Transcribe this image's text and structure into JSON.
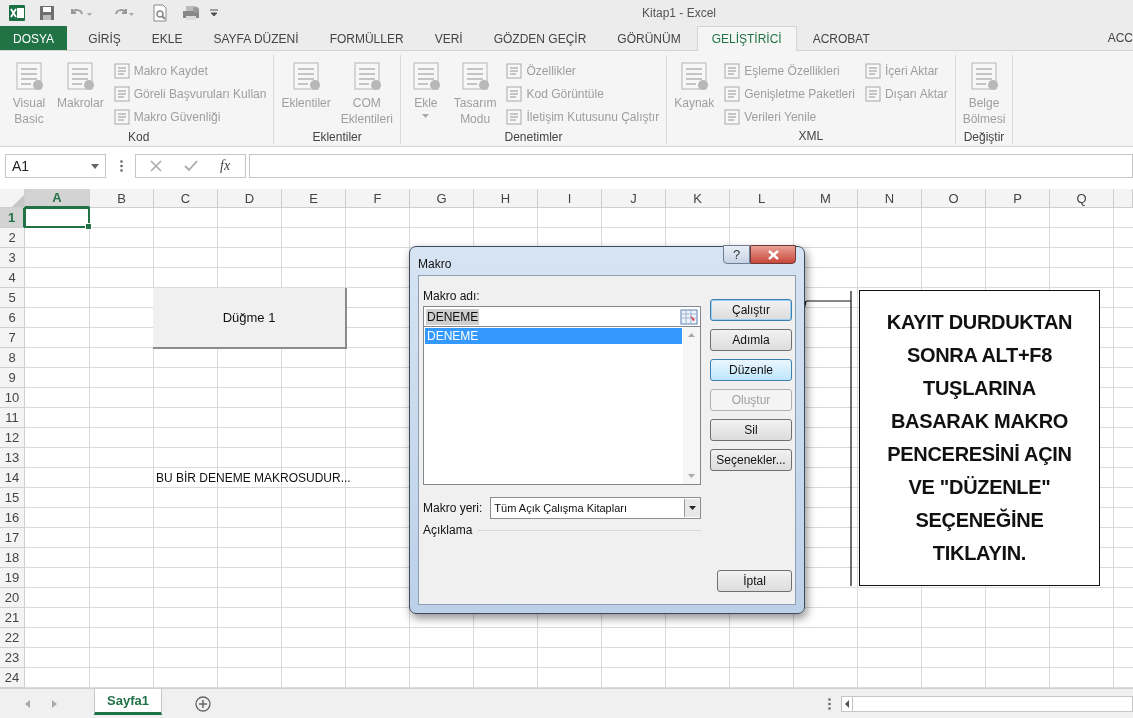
{
  "title_bar": {
    "title": "Kitap1 - Excel"
  },
  "tabs": [
    {
      "label": "DOSYA",
      "kind": "file",
      "selected": false
    },
    {
      "label": "GİRİŞ",
      "kind": "tab",
      "selected": false
    },
    {
      "label": "EKLE",
      "kind": "tab",
      "selected": false
    },
    {
      "label": "SAYFA DÜZENİ",
      "kind": "tab",
      "selected": false
    },
    {
      "label": "FORMÜLLER",
      "kind": "tab",
      "selected": false
    },
    {
      "label": "VERİ",
      "kind": "tab",
      "selected": false
    },
    {
      "label": "GÖZDEN GEÇİR",
      "kind": "tab",
      "selected": false
    },
    {
      "label": "GÖRÜNÜM",
      "kind": "tab",
      "selected": false
    },
    {
      "label": "GELİŞTİRİCİ",
      "kind": "tab",
      "selected": true
    },
    {
      "label": "ACROBAT",
      "kind": "tab",
      "selected": false
    }
  ],
  "account": "ACC",
  "ribbon": {
    "groups": [
      {
        "label": "Kod",
        "items": [
          {
            "kind": "large",
            "label": "Visual Basic",
            "disabled": true,
            "dropdown": false
          },
          {
            "kind": "large",
            "label": "Makrolar",
            "disabled": true,
            "dropdown": false
          },
          {
            "kind": "small",
            "label": "Makro Kaydet",
            "disabled": true
          },
          {
            "kind": "small",
            "label": "Göreli Başvuruları Kullan",
            "disabled": true
          },
          {
            "kind": "small",
            "label": "Makro Güvenliği",
            "disabled": true
          }
        ]
      },
      {
        "label": "Eklentiler",
        "items": [
          {
            "kind": "large",
            "label": "Eklentiler",
            "disabled": true,
            "dropdown": false
          },
          {
            "kind": "large",
            "label": "COM Eklentileri",
            "disabled": true,
            "dropdown": false
          }
        ]
      },
      {
        "label": "Denetimler",
        "items": [
          {
            "kind": "large",
            "label": "Ekle",
            "disabled": true,
            "dropdown": true
          },
          {
            "kind": "large",
            "label": "Tasarım Modu",
            "disabled": true,
            "dropdown": false
          },
          {
            "kind": "small",
            "label": "Özellikler",
            "disabled": true
          },
          {
            "kind": "small",
            "label": "Kod Görüntüle",
            "disabled": true
          },
          {
            "kind": "small",
            "label": "İletişim Kutusunu Çalıştır",
            "disabled": true
          }
        ]
      },
      {
        "label": "XML",
        "items": [
          {
            "kind": "large",
            "label": "Kaynak",
            "disabled": true,
            "dropdown": false
          },
          {
            "kind": "small",
            "label": "Eşleme Özellikleri",
            "disabled": true
          },
          {
            "kind": "small",
            "label": "Genişletme Paketleri",
            "disabled": true
          },
          {
            "kind": "small",
            "label": "Verileri Yenile",
            "disabled": true
          },
          {
            "kind": "small",
            "label": "İçeri Aktar",
            "disabled": true
          },
          {
            "kind": "small",
            "label": "Dışarı Aktar",
            "disabled": true
          }
        ]
      },
      {
        "label": "Değiştir",
        "items": [
          {
            "kind": "large",
            "label": "Belge Bölmesi",
            "disabled": true,
            "dropdown": false
          }
        ]
      }
    ]
  },
  "formula_bar": {
    "name_box": "A1",
    "function_label": "fx"
  },
  "sheet": {
    "columns": [
      {
        "label": "A",
        "selected": true
      },
      {
        "label": "B",
        "selected": false
      },
      {
        "label": "C",
        "selected": false
      },
      {
        "label": "D",
        "selected": false
      },
      {
        "label": "E",
        "selected": false
      },
      {
        "label": "F",
        "selected": false
      },
      {
        "label": "G",
        "selected": false
      },
      {
        "label": "H",
        "selected": false
      },
      {
        "label": "I",
        "selected": false
      },
      {
        "label": "J",
        "selected": false
      },
      {
        "label": "K",
        "selected": false
      },
      {
        "label": "L",
        "selected": false
      },
      {
        "label": "M",
        "selected": false
      },
      {
        "label": "N",
        "selected": false
      },
      {
        "label": "O",
        "selected": false
      },
      {
        "label": "P",
        "selected": false
      },
      {
        "label": "Q",
        "selected": false
      }
    ],
    "rows": [
      {
        "label": "1",
        "selected": true
      },
      {
        "label": "2",
        "selected": false
      },
      {
        "label": "3",
        "selected": false
      },
      {
        "label": "4",
        "selected": false
      },
      {
        "label": "5",
        "selected": false
      },
      {
        "label": "6",
        "selected": false
      },
      {
        "label": "7",
        "selected": false
      },
      {
        "label": "8",
        "selected": false
      },
      {
        "label": "9",
        "selected": false
      },
      {
        "label": "10",
        "selected": false
      },
      {
        "label": "11",
        "selected": false
      },
      {
        "label": "12",
        "selected": false
      },
      {
        "label": "13",
        "selected": false
      },
      {
        "label": "14",
        "selected": false
      },
      {
        "label": "15",
        "selected": false
      },
      {
        "label": "16",
        "selected": false
      },
      {
        "label": "17",
        "selected": false
      },
      {
        "label": "18",
        "selected": false
      },
      {
        "label": "19",
        "selected": false
      },
      {
        "label": "20",
        "selected": false
      },
      {
        "label": "21",
        "selected": false
      },
      {
        "label": "22",
        "selected": false
      },
      {
        "label": "23",
        "selected": false
      },
      {
        "label": "24",
        "selected": false
      }
    ],
    "cells": [
      {
        "text": "BU BİR DENEME MAKROSUDUR..."
      }
    ],
    "form_button": {
      "label": "Düğme 1"
    }
  },
  "dialog": {
    "title": "Makro",
    "help": "?",
    "name_label": "Makro adı:",
    "name_value": "DENEME",
    "name_value_selected": true,
    "macros": [
      {
        "label": "DENEME",
        "selected": true
      }
    ],
    "buttons": [
      {
        "label": "Çalıştır",
        "default": true,
        "hovered": false,
        "disabled": false
      },
      {
        "label": "Adımla",
        "default": false,
        "hovered": false,
        "disabled": false
      },
      {
        "label": "Düzenle",
        "default": false,
        "hovered": true,
        "disabled": false
      },
      {
        "label": "Oluştur",
        "default": false,
        "hovered": false,
        "disabled": true
      },
      {
        "label": "Sil",
        "default": false,
        "hovered": false,
        "disabled": false
      },
      {
        "label": "Seçenekler...",
        "default": false,
        "hovered": false,
        "disabled": false
      }
    ],
    "location_label": "Makro yeri:",
    "location_value": "Tüm Açık Çalışma Kitapları",
    "description_label": "Açıklama",
    "cancel": "İptal"
  },
  "callout": {
    "text": "KAYIT DURDUKTAN\nSONRA ALT+F8\nTUŞLARINA\nBASARAK MAKRO\nPENCERESİNİ AÇIN\nVE \"DÜZENLE\"\nSEÇENEĞİNE\nTIKLAYIN."
  },
  "sheet_tabs": [
    {
      "label": "Sayfa1",
      "selected": true
    }
  ]
}
